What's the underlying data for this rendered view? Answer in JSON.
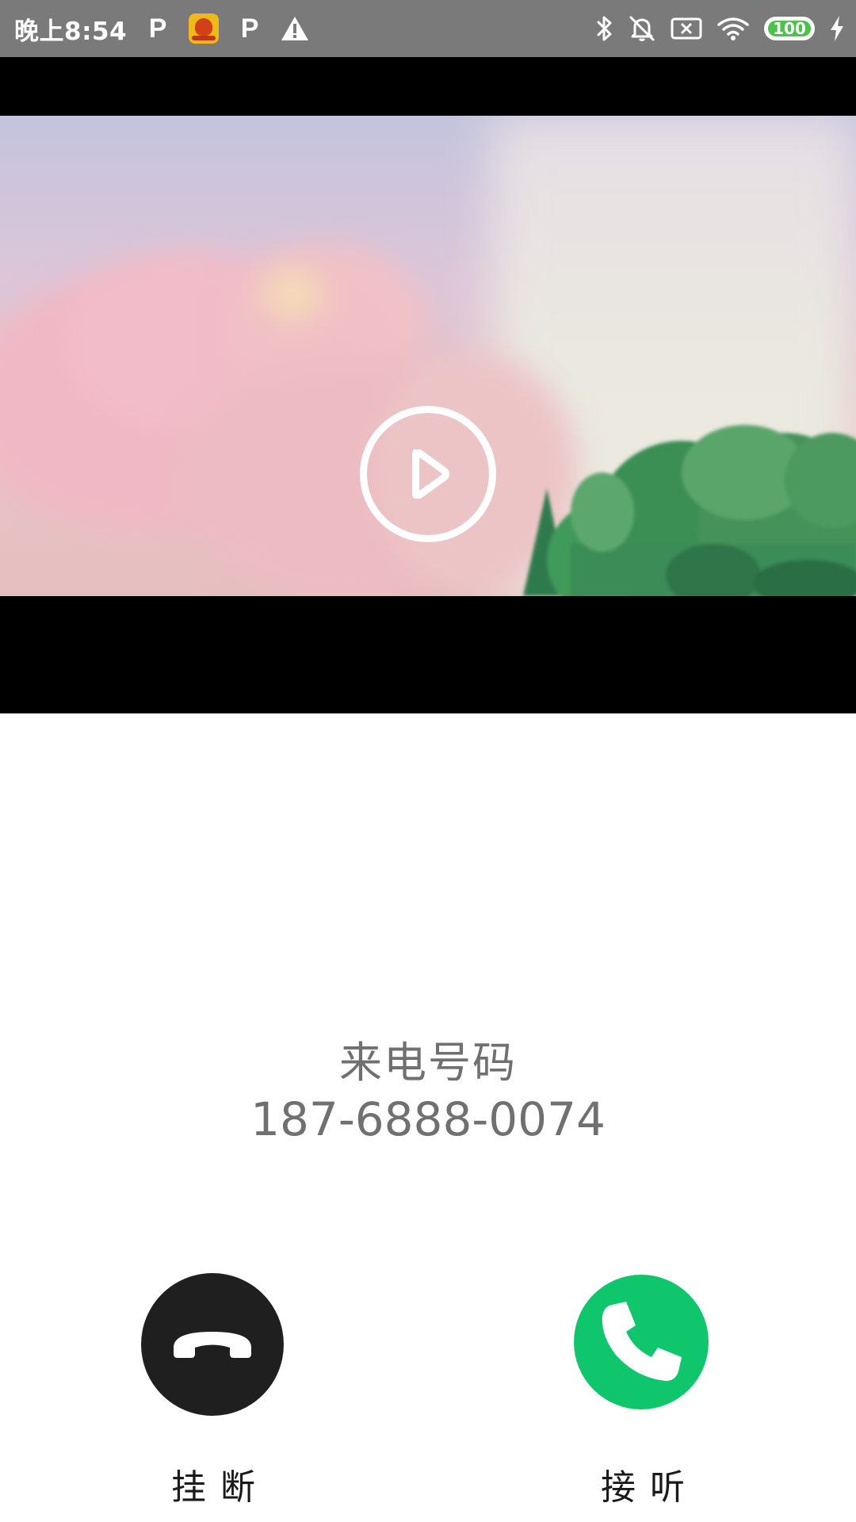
{
  "status_bar": {
    "time": "晚上8:54",
    "battery_level": "100",
    "notification_icons": [
      "parking-p-icon",
      "app-icon",
      "parking-p-icon",
      "warning-icon"
    ],
    "system_icons": [
      "bluetooth-icon",
      "mute-icon",
      "sim-x-icon",
      "wifi-icon",
      "battery-icon",
      "charging-icon"
    ]
  },
  "video": {
    "play_icon": "play-icon"
  },
  "caller": {
    "label": "来电号码",
    "number": "187-6888-0074"
  },
  "actions": {
    "hangup_label": "挂断",
    "answer_label": "接听",
    "hangup_icon": "phone-hangup-icon",
    "answer_icon": "phone-answer-icon"
  },
  "colors": {
    "status_bar": "#7a7a7a",
    "hangup": "#1f1f1f",
    "answer": "#10c66c",
    "battery": "#4cc24a",
    "caller_text": "#707070"
  }
}
